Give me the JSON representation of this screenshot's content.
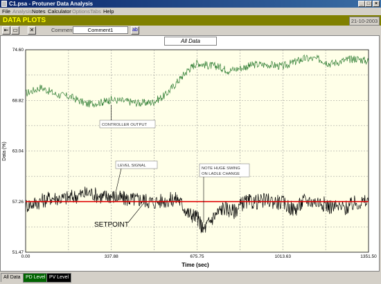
{
  "window": {
    "title": "C1.psa - Protuner Data  Analysis"
  },
  "menu": {
    "items": [
      {
        "label": "File",
        "enabled": true
      },
      {
        "label": "Analysis",
        "enabled": false
      },
      {
        "label": "Notes",
        "enabled": true
      },
      {
        "label": "Calculator",
        "enabled": true
      },
      {
        "label": "Options",
        "enabled": false
      },
      {
        "label": "Tabs",
        "enabled": false
      },
      {
        "label": "Help",
        "enabled": true
      }
    ]
  },
  "header": {
    "title": "DATA PLOTS",
    "date": "21-10-2003",
    "color": "#808000",
    "title_color": "#ffff00"
  },
  "toolbar": {
    "comment_label": "Comment",
    "comment_value": "Comment1",
    "ab_label": "ab"
  },
  "plot": {
    "title": "All Data"
  },
  "tabs": [
    {
      "label": "All Data",
      "active": true,
      "bg": "#d4d0c8",
      "fg": "#000000"
    },
    {
      "label": "PD Level",
      "active": false,
      "bg": "#006400",
      "fg": "#ffffff"
    },
    {
      "label": "PV Level",
      "active": false,
      "bg": "#000000",
      "fg": "#ffffff"
    }
  ],
  "chart_data": {
    "type": "line",
    "xlabel": "Time (sec)",
    "ylabel": "Data (%)",
    "xlim": [
      0.0,
      1351.5
    ],
    "ylim": [
      51.47,
      74.6
    ],
    "x_ticks": [
      "0.00",
      "337.88",
      "675.75",
      "1013.63",
      "1351.50"
    ],
    "y_ticks": [
      "74.60",
      "68.82",
      "63.04",
      "57.26",
      "51.47"
    ],
    "grid": true,
    "series": [
      {
        "name": "CONTROLLER OUTPUT",
        "color": "#2e7d32",
        "x": [
          0,
          60,
          120,
          180,
          240,
          300,
          337,
          400,
          450,
          500,
          550,
          600,
          640,
          676,
          720,
          760,
          800,
          860,
          900,
          960,
          1013,
          1060,
          1100,
          1160,
          1200,
          1260,
          1300,
          1351
        ],
        "y": [
          69.6,
          70.3,
          69.5,
          69.2,
          68.4,
          68.6,
          68.9,
          68.7,
          68.5,
          68.6,
          69.4,
          71.0,
          72.3,
          73.1,
          72.8,
          72.7,
          72.2,
          72.6,
          72.9,
          72.9,
          72.7,
          73.2,
          73.6,
          73.5,
          73.0,
          73.4,
          73.6,
          73.3
        ]
      },
      {
        "name": "LEVEL SIGNAL",
        "color": "#000000",
        "x": [
          0,
          50,
          100,
          150,
          200,
          250,
          300,
          337,
          380,
          420,
          460,
          500,
          560,
          600,
          640,
          676,
          700,
          740,
          780,
          820,
          860,
          900,
          960,
          1013,
          1060,
          1100,
          1160,
          1200,
          1260,
          1300,
          1351
        ],
        "y": [
          56.8,
          57.2,
          57.7,
          57.6,
          57.9,
          58.3,
          57.8,
          57.9,
          57.6,
          57.5,
          57.5,
          57.2,
          57.4,
          57.6,
          55.9,
          55.5,
          54.0,
          55.5,
          56.6,
          56.1,
          57.2,
          57.2,
          57.4,
          57.1,
          56.3,
          57.4,
          57.2,
          56.7,
          56.5,
          57.1,
          57.2
        ]
      },
      {
        "name": "SETPOINT",
        "color": "#e00000",
        "x": [
          0,
          1351.5
        ],
        "y": [
          57.26,
          57.26
        ]
      }
    ],
    "annotations": [
      {
        "text": "CONTROLLER OUTPUT",
        "x": 337,
        "y": 68.3
      },
      {
        "text": "LEVEL SIGNAL",
        "x": 390,
        "y": 59.4
      },
      {
        "text": "NOTE HUGE SWING ON LADLE CHANGE",
        "x": 676,
        "y": 55.8
      },
      {
        "text": "SETPOINT",
        "x": 220,
        "y": 57.26
      }
    ]
  }
}
